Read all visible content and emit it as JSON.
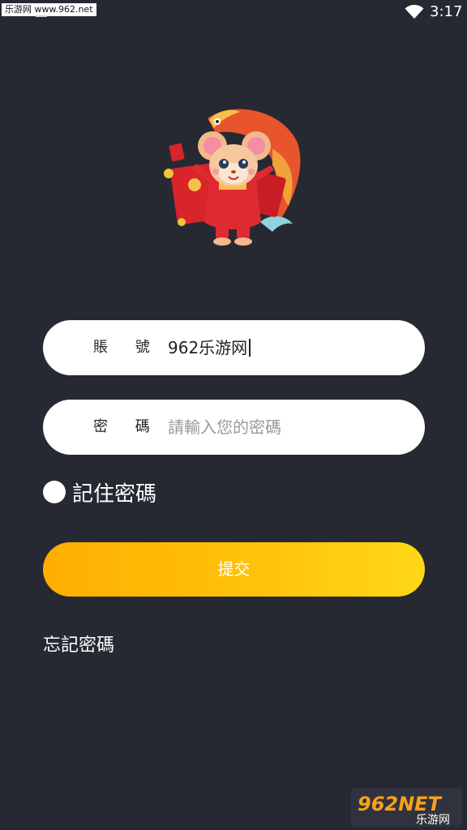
{
  "status_bar": {
    "watermark": "乐游网 www.962.net",
    "time": "3:17",
    "wifi_icon": "wifi-icon"
  },
  "mascot": {
    "icon": "mouse-koi-mascot"
  },
  "account": {
    "label": "賬 號",
    "value": "962乐游网"
  },
  "password": {
    "label": "密 碼",
    "placeholder": "請輸入您的密碼"
  },
  "remember": {
    "label": "記住密碼",
    "checked": false
  },
  "submit": {
    "label": "提交"
  },
  "forgot": {
    "label": "忘記密碼"
  },
  "watermark_bottom": {
    "brand": "962NET",
    "sub": "乐游网"
  },
  "colors": {
    "background": "#262932",
    "button_start": "#ffae00",
    "button_end": "#ffd816",
    "field": "#ffffff"
  }
}
